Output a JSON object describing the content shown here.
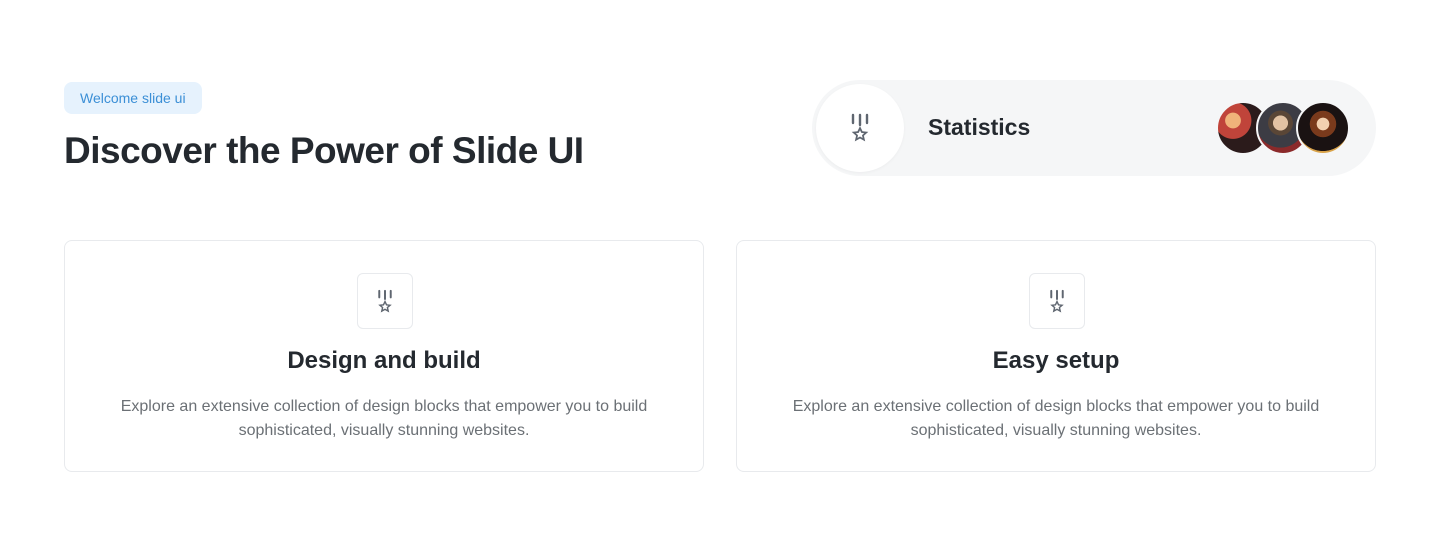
{
  "header": {
    "badge": "Welcome slide ui",
    "title": "Discover the Power of Slide UI"
  },
  "stats": {
    "label": "Statistics",
    "icon": "medal-star-icon",
    "avatars": [
      "user-avatar-1",
      "user-avatar-2",
      "user-avatar-3"
    ]
  },
  "features": [
    {
      "icon": "medal-star-icon",
      "title": "Design and build",
      "desc_line1": "Explore an extensive collection of design blocks that empower you to build",
      "desc_line2": "sophisticated, visually stunning websites."
    },
    {
      "icon": "medal-star-icon",
      "title": "Easy setup",
      "desc_line1": "Explore an extensive collection of design blocks that empower you to build",
      "desc_line2": "sophisticated, visually stunning websites."
    }
  ],
  "colors": {
    "badge_bg": "#e6f2fd",
    "badge_text": "#3b8fd6",
    "pill_bg": "#f5f6f7",
    "icon": "#5f6670",
    "border": "#e8eaed"
  }
}
